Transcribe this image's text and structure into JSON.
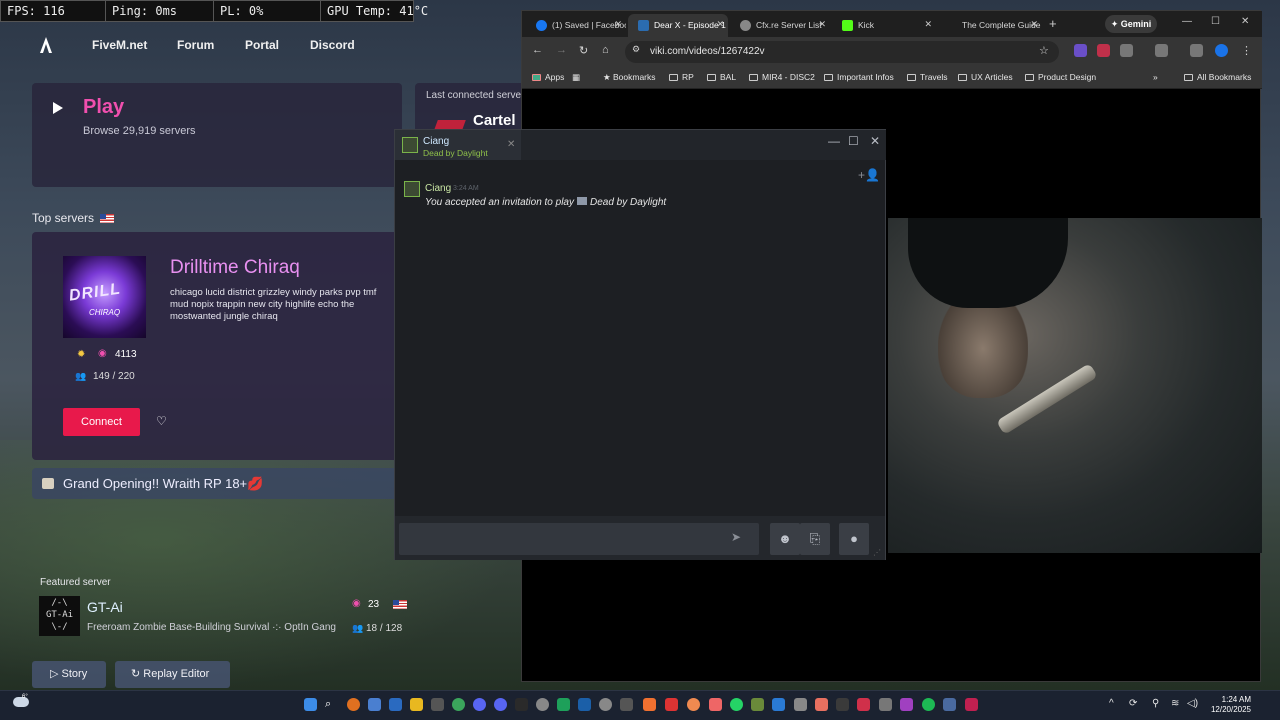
{
  "hud": {
    "fps": "FPS: 116",
    "ping": "Ping: 0ms",
    "pl": "PL: 0%",
    "gpu": "GPU Temp: 41°C"
  },
  "fivem": {
    "nav": [
      "FiveM.net",
      "Forum",
      "Portal",
      "Discord"
    ],
    "play_label": "Play",
    "browse_text": "Browse 29,919 servers",
    "last_connected_label": "Last connected server",
    "last_server_name": "Cartel",
    "top_servers_label": "Top servers",
    "top_server": {
      "logo_text": "DRILL",
      "logo_sub": "CHIRAQ",
      "name": "Drilltime Chiraq",
      "description": "chicago lucid district grizzley windy parks pvp tmf mud nopix trappin new city highlife echo the mostwanted jungle chiraq",
      "boosts": "4113",
      "players": "149 / 220",
      "connect_label": "Connect"
    },
    "banner_text": "Grand Opening!! Wraith RP 18+💋",
    "featured_label": "Featured server",
    "featured": {
      "logo": "/-\\\nGT-Ai\n\\-/",
      "name": "GT-Ai",
      "description": "Freeroam Zombie Base-Building Survival ·:· OptIn Gang PvP",
      "boosts": "23",
      "players": "18 / 128"
    },
    "buttons": {
      "story": "Story",
      "replay": "Replay Editor"
    }
  },
  "chrome": {
    "tabs": [
      {
        "title": "(1) Saved | Facebook",
        "color": "#1877f2"
      },
      {
        "title": "Dear X - Episode 1",
        "color": "#2b6cb0"
      },
      {
        "title": "Cfx.re Server List",
        "color": "#888888"
      },
      {
        "title": "Kick",
        "color": "#53fc18"
      },
      {
        "title": "The Complete Guide",
        "color": "#444444"
      }
    ],
    "gemini_label": "Gemini",
    "url": "viki.com/videos/1267422v",
    "bookmarks": [
      "Apps",
      "Bookmarks",
      "RP",
      "BAL",
      "MIR4 - DISC2",
      "Important Infos",
      "Travels",
      "UX Articles",
      "Product Design"
    ],
    "all_bookmarks": "All Bookmarks"
  },
  "chat": {
    "friend_name": "Ciang",
    "friend_game": "Dead by Daylight",
    "message_time": "3:24 AM",
    "message_prefix": "You accepted an invitation to play",
    "message_game": "Dead by Daylight",
    "input_placeholder": ""
  },
  "taskbar": {
    "temp": "6°",
    "time": "1:24 AM",
    "date": "12/20/2025"
  }
}
